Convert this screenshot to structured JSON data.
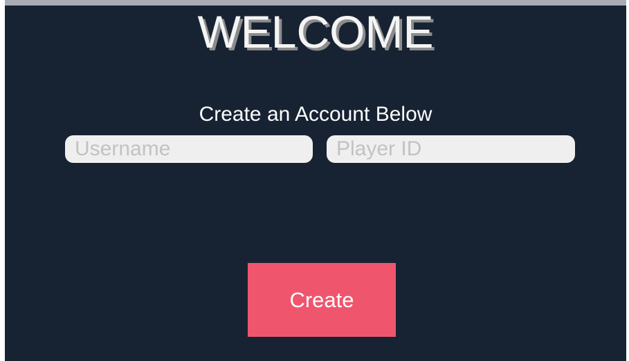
{
  "screen": {
    "title": "WELCOME",
    "subtitle": "Create an Account Below",
    "fields": {
      "username": {
        "value": "",
        "placeholder": "Username"
      },
      "player_id": {
        "value": "",
        "placeholder": "Player ID"
      }
    },
    "create_label": "Create"
  },
  "colors": {
    "background": "#172333",
    "top_strip": "#a9adb3",
    "title": "#f4f4f4",
    "title_shadow": "#8c8c8c",
    "field_background": "#efefef",
    "placeholder": "#c2c2c2",
    "button": "#ef566e",
    "button_text": "#ffffff"
  }
}
